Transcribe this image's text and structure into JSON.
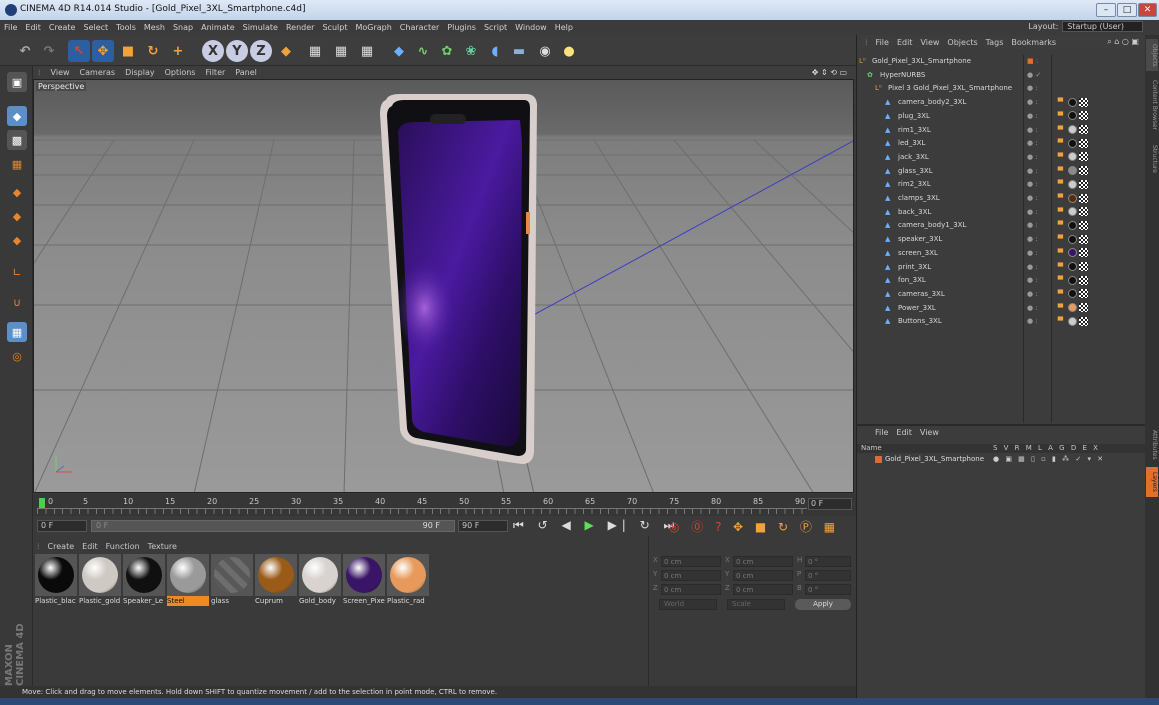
{
  "window": {
    "title": "CINEMA 4D R14.014 Studio - [Gold_Pixel_3XL_Smartphone.c4d]",
    "min": "–",
    "max": "□",
    "close": "✕"
  },
  "menubar": [
    "File",
    "Edit",
    "Create",
    "Select",
    "Tools",
    "Mesh",
    "Snap",
    "Animate",
    "Simulate",
    "Render",
    "Sculpt",
    "MoGraph",
    "Character",
    "Plugins",
    "Script",
    "Window",
    "Help"
  ],
  "layout": {
    "label": "Layout:",
    "value": "Startup (User)"
  },
  "viewport": {
    "menu": [
      "View",
      "Cameras",
      "Display",
      "Options",
      "Filter",
      "Panel"
    ],
    "label": "Perspective"
  },
  "timeline": {
    "ticks": [
      "0",
      "5",
      "10",
      "15",
      "20",
      "25",
      "30",
      "35",
      "40",
      "45",
      "50",
      "55",
      "60",
      "65",
      "70",
      "75",
      "80",
      "85",
      "90"
    ],
    "end_field": "0 F"
  },
  "anim": {
    "start": "0 F",
    "min": "0 F",
    "max": "90 F",
    "end": "90 F"
  },
  "material_manager": {
    "menu": [
      "Create",
      "Edit",
      "Function",
      "Texture"
    ],
    "materials": [
      {
        "label": "Plastic_blac",
        "color": "#0a0a0a"
      },
      {
        "label": "Plastic_gold",
        "color": "#cfc9c4"
      },
      {
        "label": "Speaker_Le",
        "color": "#101010"
      },
      {
        "label": "Steel",
        "color": "#9a9a9a",
        "selected": true
      },
      {
        "label": "glass",
        "color": "#6c6c6c"
      },
      {
        "label": "Cuprum",
        "color": "#9a5a18"
      },
      {
        "label": "Gold_body",
        "color": "#d8d3cf"
      },
      {
        "label": "Screen_Pixe",
        "color": "#3a1466"
      },
      {
        "label": "Plastic_rad",
        "color": "#e79a5c"
      }
    ]
  },
  "coords": {
    "x": {
      "label": "X",
      "pos": "0 cm",
      "size_label": "X",
      "size": "0 cm",
      "rot_label": "H",
      "rot": "0 °"
    },
    "y": {
      "label": "Y",
      "pos": "0 cm",
      "size_label": "Y",
      "size": "0 cm",
      "rot_label": "P",
      "rot": "0 °"
    },
    "z": {
      "label": "Z",
      "pos": "0 cm",
      "size_label": "Z",
      "size": "0 cm",
      "rot_label": "B",
      "rot": "0 °"
    },
    "mode": "World",
    "scale": "Scale",
    "apply": "Apply"
  },
  "object_manager": {
    "menu": [
      "File",
      "Edit",
      "View",
      "Objects",
      "Tags",
      "Bookmarks"
    ],
    "objects": [
      {
        "name": "Gold_Pixel_3XL_Smartphone",
        "indent": 0
      },
      {
        "name": "HyperNURBS",
        "indent": 1
      },
      {
        "name": "Pixel 3 Gold_Pixel_3XL_Smartphone",
        "indent": 2
      },
      {
        "name": "camera_body2_3XL",
        "indent": 3
      },
      {
        "name": "plug_3XL",
        "indent": 3
      },
      {
        "name": "rim1_3XL",
        "indent": 3
      },
      {
        "name": "led_3XL",
        "indent": 3
      },
      {
        "name": "jack_3XL",
        "indent": 3
      },
      {
        "name": "glass_3XL",
        "indent": 3
      },
      {
        "name": "rim2_3XL",
        "indent": 3
      },
      {
        "name": "clamps_3XL",
        "indent": 3
      },
      {
        "name": "back_3XL",
        "indent": 3
      },
      {
        "name": "camera_body1_3XL",
        "indent": 3
      },
      {
        "name": "speaker_3XL",
        "indent": 3
      },
      {
        "name": "screen_3XL",
        "indent": 3
      },
      {
        "name": "print_3XL",
        "indent": 3
      },
      {
        "name": "fon_3XL",
        "indent": 3
      },
      {
        "name": "cameras_3XL",
        "indent": 3
      },
      {
        "name": "Power_3XL",
        "indent": 3
      },
      {
        "name": "Buttons_3XL",
        "indent": 3
      }
    ]
  },
  "layer_manager": {
    "menu": [
      "File",
      "Edit",
      "View"
    ],
    "header": {
      "name": "Name",
      "cols": "S V R M L A G D E X"
    },
    "row": "Gold_Pixel_3XL_Smartphone"
  },
  "right_tabs": [
    "Objects",
    "Content Browser",
    "Structure",
    "Attributes",
    "Layers"
  ],
  "status": "Move: Click and drag to move elements. Hold down SHIFT to quantize movement / add to the selection in point mode, CTRL to remove.",
  "brand": "MAXON CINEMA 4D"
}
